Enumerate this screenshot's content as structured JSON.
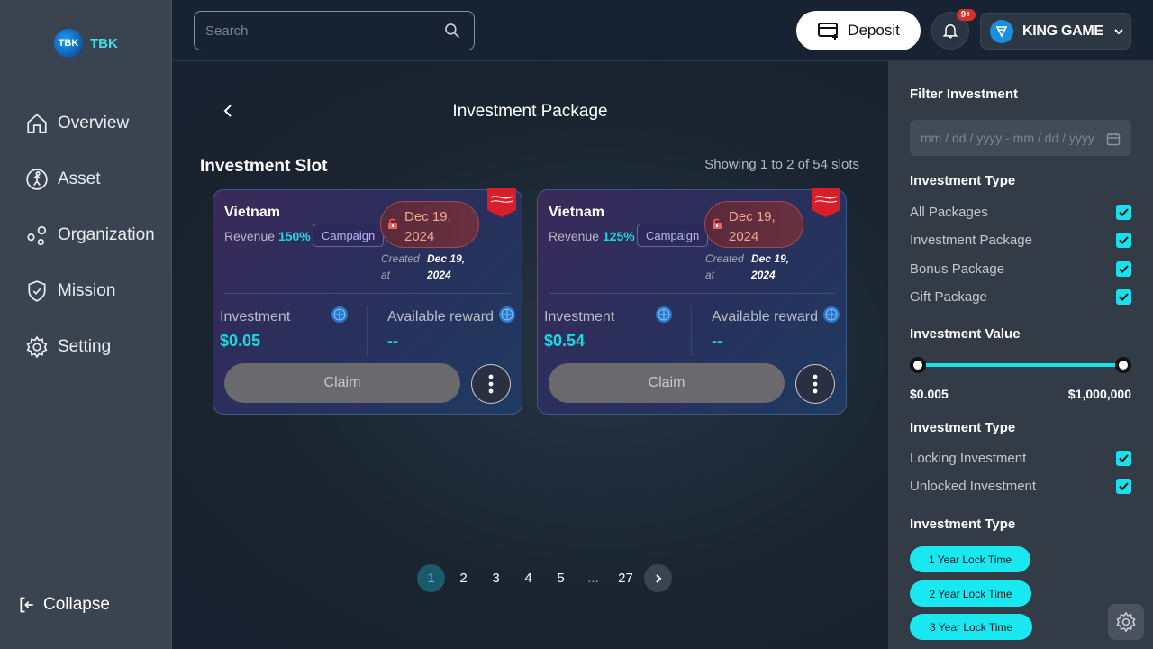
{
  "brand": {
    "logo_text": "TBK",
    "name": "TBK"
  },
  "sidebar": {
    "items": [
      {
        "label": "Overview",
        "icon": "home-icon"
      },
      {
        "label": "Asset",
        "icon": "asset-icon"
      },
      {
        "label": "Organization",
        "icon": "organization-icon"
      },
      {
        "label": "Mission",
        "icon": "mission-icon"
      },
      {
        "label": "Setting",
        "icon": "gear-icon"
      }
    ],
    "collapse_label": "Collapse"
  },
  "topbar": {
    "search_placeholder": "Search",
    "deposit_label": "Deposit",
    "notification_count": "9+",
    "user_name": "KING GAME"
  },
  "main": {
    "page_title": "Investment Package",
    "section_title": "Investment Slot",
    "showing_text": "Showing 1 to 2 of 54 slots",
    "cards": [
      {
        "country": "Vietnam",
        "revenue_label": "Revenue",
        "revenue_value": "150%",
        "tag": "Campaign",
        "date_line1": "Dec 19,",
        "date_line2": "2024",
        "created_line1": "Created",
        "created_line2": "at",
        "created_date1": "Dec 19,",
        "created_date2": "2024",
        "investment_label": "Investment",
        "investment_value": "$0.05",
        "reward_label": "Available reward",
        "reward_value": "--",
        "claim_label": "Claim"
      },
      {
        "country": "Vietnam",
        "revenue_label": "Revenue",
        "revenue_value": "125%",
        "tag": "Campaign",
        "date_line1": "Dec 19,",
        "date_line2": "2024",
        "created_line1": "Created",
        "created_line2": "at",
        "created_date1": "Dec 19,",
        "created_date2": "2024",
        "investment_label": "Investment",
        "investment_value": "$0.54",
        "reward_label": "Available reward",
        "reward_value": "--",
        "claim_label": "Claim"
      }
    ],
    "pagination": [
      "1",
      "2",
      "3",
      "4",
      "5",
      "...",
      "27"
    ]
  },
  "filter": {
    "title": "Filter Investment",
    "date_placeholder": "mm / dd / yyyy  -  mm / dd / yyyy",
    "type_heading_1": "Investment Type",
    "types": [
      "All Packages",
      "Investment Package",
      "Bonus Package",
      "Gift Package"
    ],
    "value_heading": "Investment Value",
    "value_min": "$0.005",
    "value_max": "$1,000,000",
    "type_heading_2": "Investment Type",
    "lock_types": [
      "Locking Investment",
      "Unlocked Investment"
    ],
    "type_heading_3": "Investment Type",
    "lock_times": [
      "1 Year Lock Time",
      "2 Year Lock Time",
      "3 Year Lock Time"
    ]
  },
  "colors": {
    "accent": "#19e0ea",
    "sidebar": "#3a4350",
    "panel": "#333b46"
  }
}
